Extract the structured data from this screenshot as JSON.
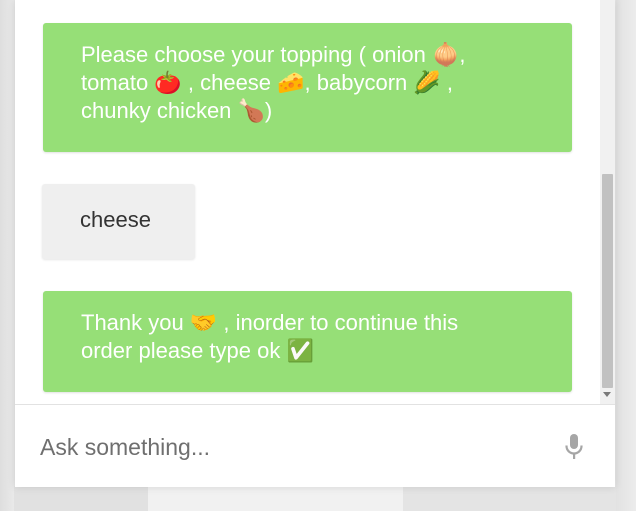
{
  "chat": {
    "messages": [
      {
        "sender": "bot",
        "lines": [
          "Please choose your topping ( onion 🧅,",
          "tomato 🍅 , cheese 🧀, babycorn 🌽 ,",
          "chunky chicken 🍗)"
        ]
      },
      {
        "sender": "user",
        "lines": [
          "cheese"
        ]
      },
      {
        "sender": "bot",
        "lines": [
          "Thank you 🤝 , inorder to continue this",
          "order please type ok ✅"
        ]
      }
    ]
  },
  "input": {
    "placeholder": "Ask something...",
    "value": ""
  },
  "icons": {
    "mic": "microphone-icon",
    "scroll_down": "scroll-down-arrow-icon"
  },
  "colors": {
    "bot_bubble": "#96df77",
    "bot_text": "#ffffff",
    "user_bubble": "#efefef",
    "user_text": "#333333",
    "mic_icon": "#a6a6a6"
  }
}
